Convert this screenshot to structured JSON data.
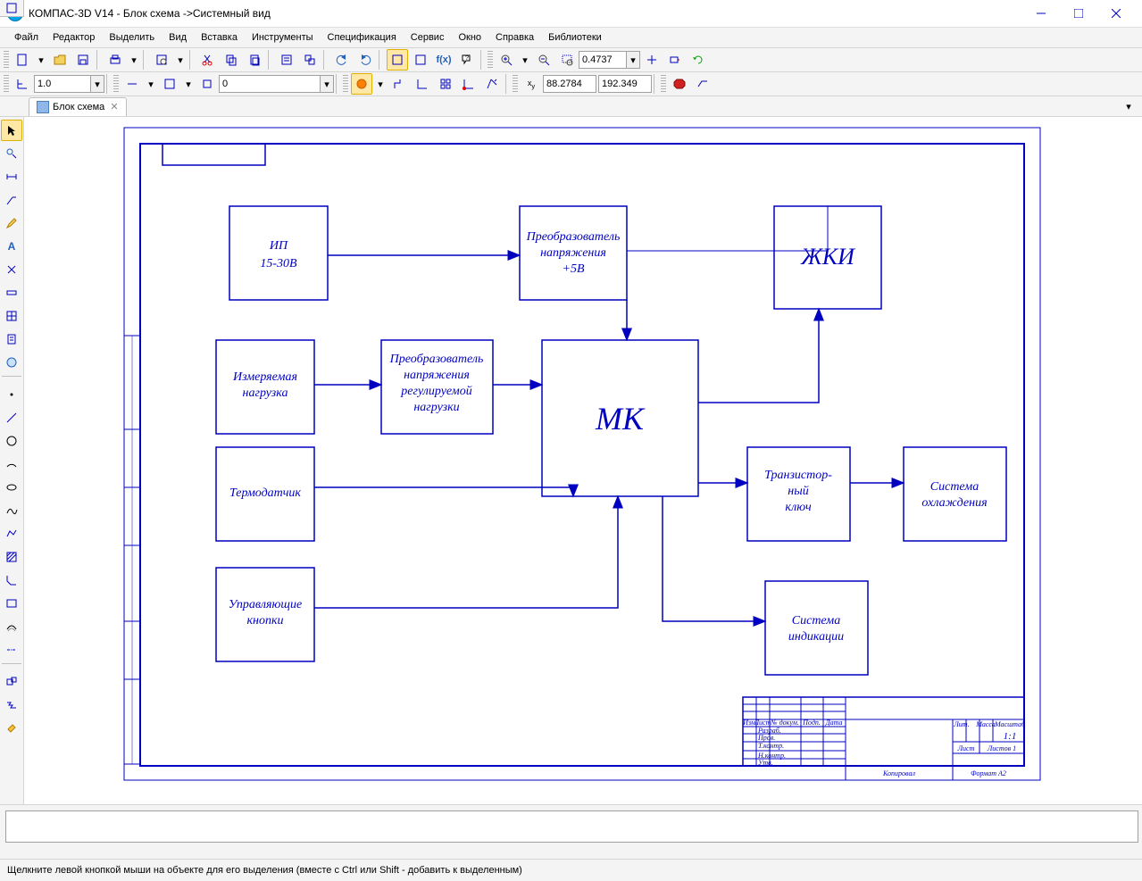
{
  "app": {
    "title": "КОМПАС-3D V14 - Блок схема ->Системный вид"
  },
  "menu": {
    "items": [
      "Файл",
      "Редактор",
      "Выделить",
      "Вид",
      "Вставка",
      "Инструменты",
      "Спецификация",
      "Сервис",
      "Окно",
      "Справка",
      "Библиотеки"
    ]
  },
  "toolbar2": {
    "scale": "1.0",
    "step": "0",
    "zoom": "0.4737",
    "coord_x": "88.2784",
    "coord_y": "192.349"
  },
  "tab": {
    "label": "Блок схема"
  },
  "status": {
    "text": "Щелкните левой кнопкой мыши на объекте для его выделения (вместе с Ctrl или Shift - добавить к выделенным)"
  },
  "diagram": {
    "b1_l1": "ИП",
    "b1_l2": "15-30В",
    "b2_l1": "Преобразователь",
    "b2_l2": "напряжения",
    "b2_l3": "+5В",
    "b3": "ЖКИ",
    "b4_l1": "Измеряемая",
    "b4_l2": "нагрузка",
    "b5_l1": "Преобразователь",
    "b5_l2": "напряжения",
    "b5_l3": "регулируемой",
    "b5_l4": "нагрузки",
    "b6": "МК",
    "b7": "Термодатчик",
    "b8_l1": "Транзистор-",
    "b8_l2": "ный",
    "b8_l3": "ключ",
    "b9_l1": "Система",
    "b9_l2": "охлаждения",
    "b10_l1": "Управляющие",
    "b10_l2": "кнопки",
    "b11_l1": "Система",
    "b11_l2": "индикации",
    "stamp_scale": "1:1",
    "stamp_list": "Лист",
    "stamp_listov": "Листов  1",
    "stamp_lit": "Лит.",
    "stamp_massa": "Масса",
    "stamp_masshtab": "Масштаб",
    "stamp_format": "Формат    А2",
    "stamp_kopiroval": "Копировал",
    "stamp_izm": "Изм.",
    "stamp_listh": "Лист",
    "stamp_ndoc": "№ докум.",
    "stamp_podp": "Подп.",
    "stamp_data": "Дата",
    "stamp_razrab": "Разраб.",
    "stamp_prov": "Пров.",
    "stamp_tkontr": "Т.контр.",
    "stamp_nkontr": "Н.контр.",
    "stamp_utv": "Утв."
  }
}
